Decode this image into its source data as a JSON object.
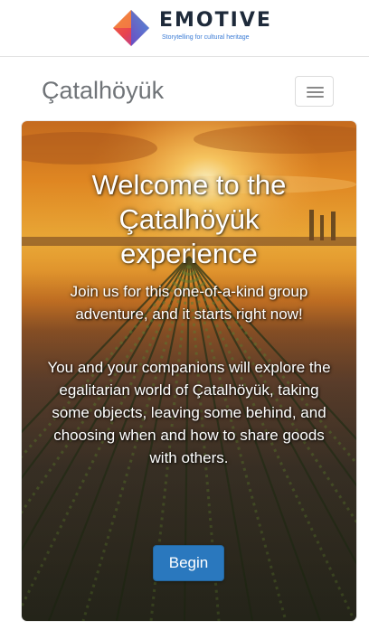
{
  "brand": {
    "name": "EMOTIVE",
    "tagline": "Storytelling for cultural heritage",
    "logo_colors": [
      "#e8434f",
      "#f0883e",
      "#3d6fd6",
      "#6a3fb8"
    ]
  },
  "header": {
    "site_title": "Çatalhöyük",
    "menu_icon": "hamburger-menu-icon"
  },
  "hero": {
    "heading_line1": "Welcome to the",
    "heading_line2": "Çatalhöyük",
    "heading_line3": "experience",
    "intro": "Join us for this one-of-a-kind group adventure, and it starts right now!",
    "description": "You and your companions will explore the egalitarian world of Çatalhöyük, taking some objects, leaving some behind, and choosing when and how to share goods with others.",
    "begin_label": "Begin",
    "background": "sunset field with rows of crops"
  },
  "colors": {
    "button_primary": "#2a78be",
    "title_gray": "#707478"
  }
}
